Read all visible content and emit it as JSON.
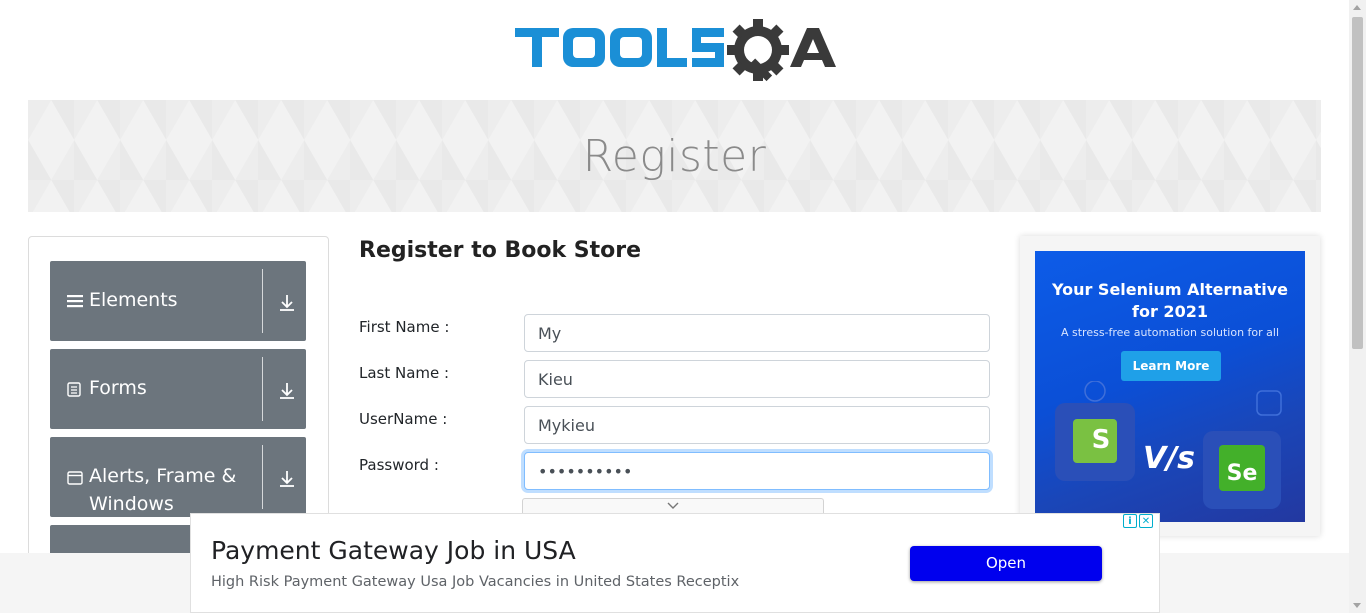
{
  "logo": {
    "alt": "TOOLSQA",
    "brand_blue": "#1b8fd6",
    "brand_dark": "#3a3a3a"
  },
  "banner": {
    "title": "Register"
  },
  "sidebar": {
    "groups": [
      {
        "label": "Elements",
        "icon": "menu-icon"
      },
      {
        "label": "Forms",
        "icon": "document-icon"
      },
      {
        "label_line1": "Alerts, Frame &",
        "label_line2": "Windows",
        "icon": "window-icon"
      }
    ]
  },
  "form": {
    "heading": "Register to Book Store",
    "fields": [
      {
        "label": "First Name :",
        "value": "My"
      },
      {
        "label": "Last Name :",
        "value": "Kieu"
      },
      {
        "label": "UserName :",
        "value": "Mykieu"
      },
      {
        "label": "Password :",
        "value": "••••••••••"
      }
    ]
  },
  "right_ad": {
    "title_line1": "Your Selenium Alternative",
    "title_line2": "for 2021",
    "subtitle": "A stress-free automation solution for all",
    "button": "Learn More",
    "vs_text": "V/s",
    "left_logo_text": "S",
    "right_logo_text": "Se"
  },
  "bottom_ad": {
    "headline": "Payment Gateway Job in USA",
    "description": "High Risk Payment Gateway Usa Job Vacancies in United States Receptix",
    "button": "Open",
    "info_glyph": "i",
    "close_glyph": "✕"
  },
  "colors": {
    "sidebar_group": "#6c757d",
    "open_button": "#0000ee",
    "learn_more": "#1fa0e8"
  }
}
